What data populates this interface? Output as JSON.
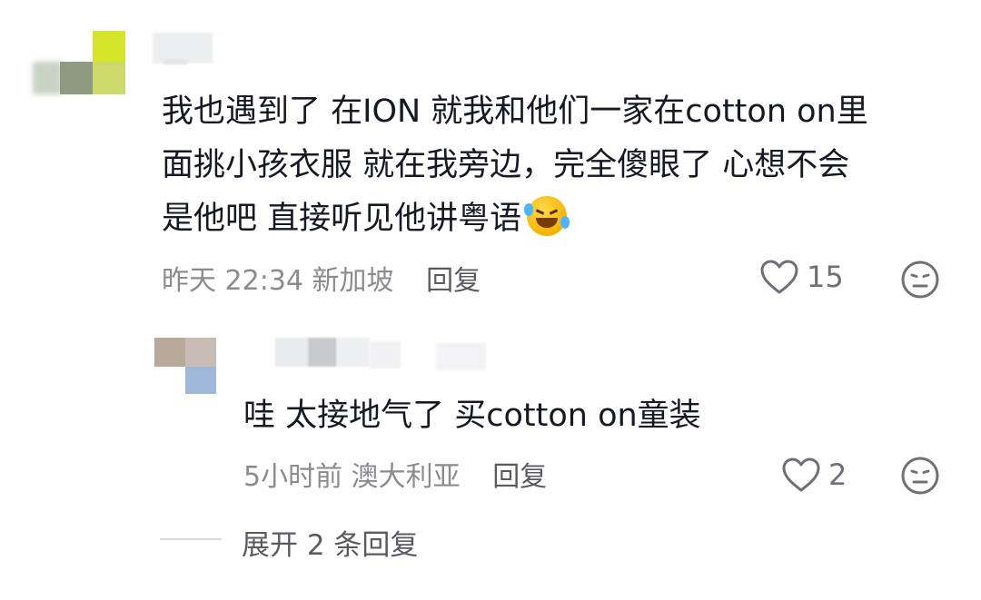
{
  "comment": {
    "text_line1": "我也遇到了 在ION 就我和他们一家在cotton on里",
    "text_line2": "面挑小孩衣服 就在我旁边，完全傻眼了 心想不会",
    "text_line3": "是他吧 直接听见他讲粤语",
    "emoji_icon": "rolling-on-floor-laughing-emoji",
    "time": "昨天 22:34",
    "location": "新加坡",
    "reply_label": "回复",
    "likes": "15"
  },
  "reply": {
    "text": "哇 太接地气了 买cotton on童装",
    "time": "5小时前",
    "location": "澳大利亚",
    "reply_label": "回复",
    "likes": "2"
  },
  "expand": {
    "label": "展开 2 条回复"
  },
  "colors": {
    "text": "#161823",
    "meta": "#8a8b91",
    "icon": "#6f7077"
  }
}
